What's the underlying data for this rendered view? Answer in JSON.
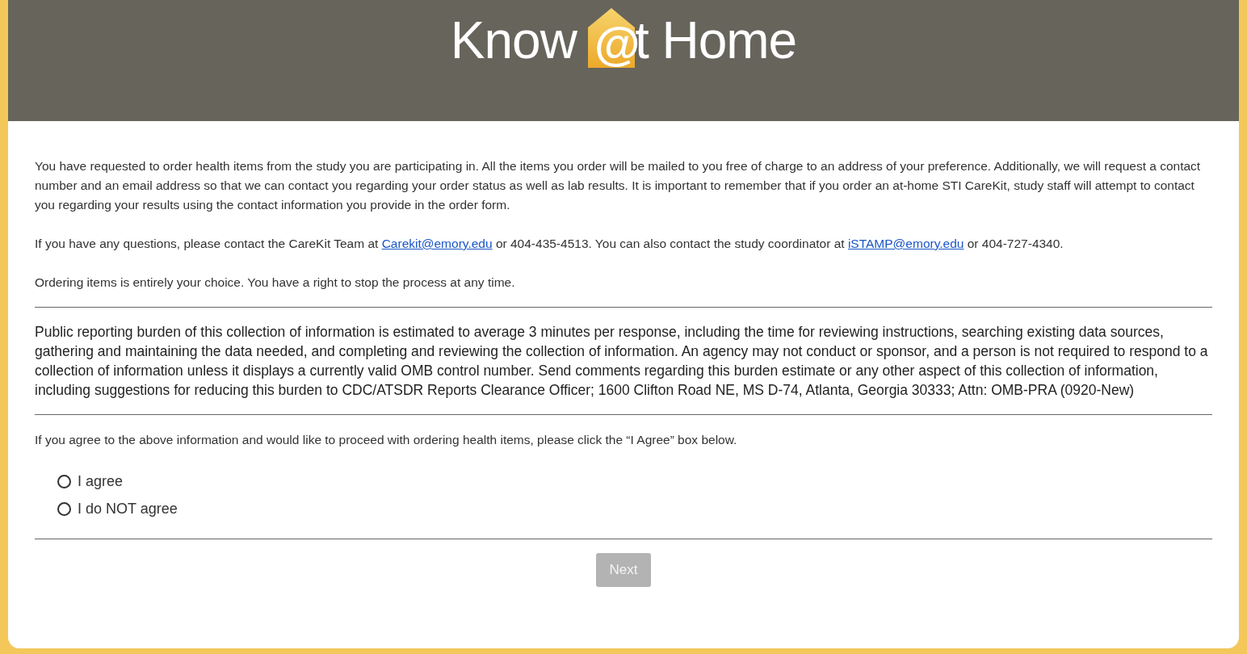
{
  "logo": {
    "before": "Know",
    "mark": "@",
    "after": "t Home"
  },
  "intro": [
    {
      "kind": "text",
      "parts": [
        {
          "kind": "text",
          "text": "You have requested to order health items from the study you are participating in. All the items you order will be mailed to you free of charge to an address of your preference. Additionally, we will request a contact number and an email address so that we can contact you regarding your order status as well as lab results.  It is important to remember that if you order an at-home STI CareKit, study staff will attempt to contact you regarding your results using the contact information you provide in the order form."
        }
      ]
    },
    {
      "kind": "text",
      "parts": [
        {
          "kind": "text",
          "text": "If you have any questions, please contact the CareKit Team at "
        },
        {
          "kind": "link",
          "text": "Carekit@emory.edu"
        },
        {
          "kind": "text",
          "text": " or 404-435-4513. You can also contact the study coordinator at "
        },
        {
          "kind": "link",
          "text": "iSTAMP@emory.edu"
        },
        {
          "kind": "text",
          "text": " or 404-727-4340."
        }
      ]
    },
    {
      "kind": "text",
      "parts": [
        {
          "kind": "text",
          "text": "Ordering items is entirely your choice.  You have a right to stop the process at any time."
        }
      ]
    }
  ],
  "burden": "Public reporting burden of this collection of information is estimated to average 3 minutes per response, including the time for reviewing instructions, searching existing data sources, gathering and maintaining the data needed, and completing and reviewing the collection of information.  An agency may not conduct or sponsor, and a person is not required to respond to a collection of information unless it displays a currently valid OMB control number.  Send comments regarding this burden estimate or any other aspect of this collection of information, including suggestions for reducing this burden to CDC/ATSDR Reports Clearance Officer; 1600 Clifton Road NE, MS D-74, Atlanta, Georgia 30333; Attn: OMB-PRA (0920-New)",
  "question": "If you agree to the above information and would like to proceed with ordering health items, please click the “I Agree” box below.",
  "options": [
    {
      "label": "I agree",
      "selected": false
    },
    {
      "label": "I do NOT agree",
      "selected": false
    }
  ],
  "next_button": {
    "label": "Next",
    "disabled": true
  }
}
